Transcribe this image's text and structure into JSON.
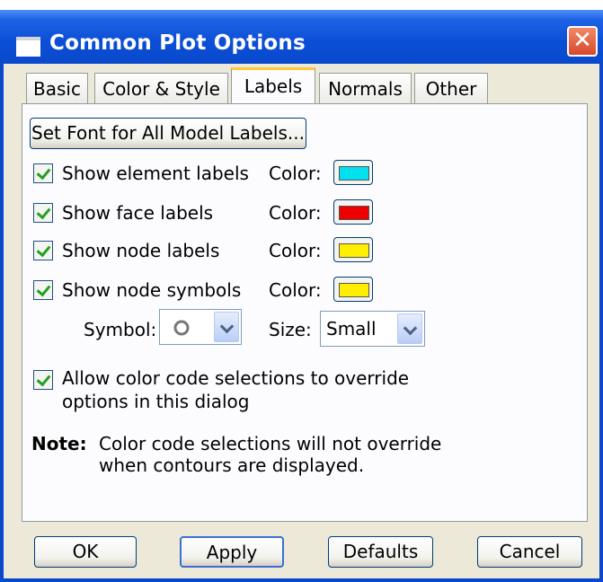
{
  "window": {
    "title": "Common Plot Options",
    "close_glyph": "✕"
  },
  "tabs": [
    {
      "label": "Basic"
    },
    {
      "label": "Color & Style"
    },
    {
      "label": "Labels"
    },
    {
      "label": "Normals"
    },
    {
      "label": "Other"
    }
  ],
  "active_tab": "Labels",
  "set_font_button": "Set Font for All Model Labels...",
  "label_rows": [
    {
      "label": "Show element labels",
      "checked": true,
      "color_label": "Color:",
      "color": "#00e0ee"
    },
    {
      "label": "Show face labels",
      "checked": true,
      "color_label": "Color:",
      "color": "#ee0000"
    },
    {
      "label": "Show node labels",
      "checked": true,
      "color_label": "Color:",
      "color": "#ffee00"
    },
    {
      "label": "Show node symbols",
      "checked": true,
      "color_label": "Color:",
      "color": "#ffee00"
    }
  ],
  "symbol": {
    "label": "Symbol:",
    "value_icon": "hollow-circle-icon"
  },
  "size": {
    "label": "Size:",
    "value": "Small"
  },
  "override": {
    "checked": true,
    "line1": "Allow color code selections to override",
    "line2": "options in this dialog"
  },
  "note": {
    "label": "Note:",
    "line1": "Color code selections will not override",
    "line2": "when contours are displayed."
  },
  "buttons": {
    "ok": "OK",
    "apply": "Apply",
    "defaults": "Defaults",
    "cancel": "Cancel"
  }
}
